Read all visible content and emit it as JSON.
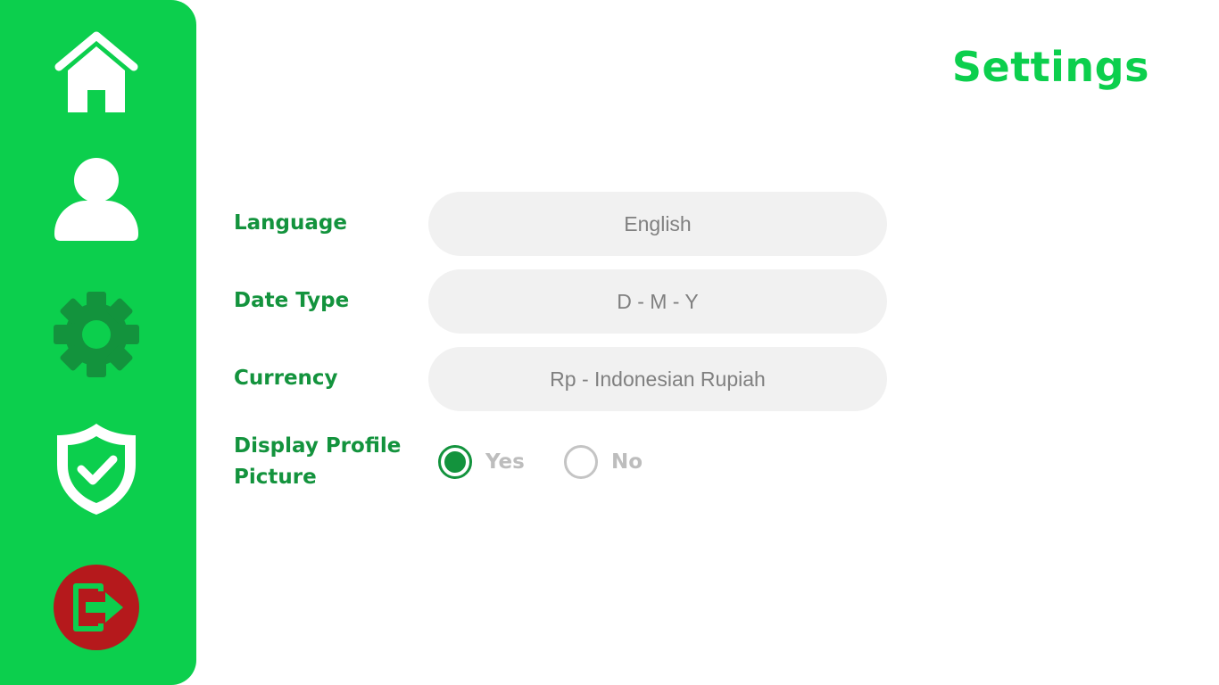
{
  "title": "Settings",
  "sidebar": {
    "items": [
      {
        "icon": "home-icon"
      },
      {
        "icon": "user-icon"
      },
      {
        "icon": "gear-icon"
      },
      {
        "icon": "shield-check-icon"
      },
      {
        "icon": "logout-icon"
      }
    ]
  },
  "settings": {
    "language": {
      "label": "Language",
      "value": "English"
    },
    "date_type": {
      "label": "Date Type",
      "value": "D - M - Y"
    },
    "currency": {
      "label": "Currency",
      "value": "Rp - Indonesian Rupiah"
    },
    "display_profile_picture": {
      "label_line1": "Display Profile",
      "label_line2": "Picture",
      "options": [
        {
          "label": "Yes",
          "selected": true
        },
        {
          "label": "No",
          "selected": false
        }
      ]
    }
  },
  "colors": {
    "brand_green": "#0ccf4d",
    "label_green": "#13933d",
    "field_bg": "#f1f1f1",
    "logout_red": "#b5191c"
  }
}
